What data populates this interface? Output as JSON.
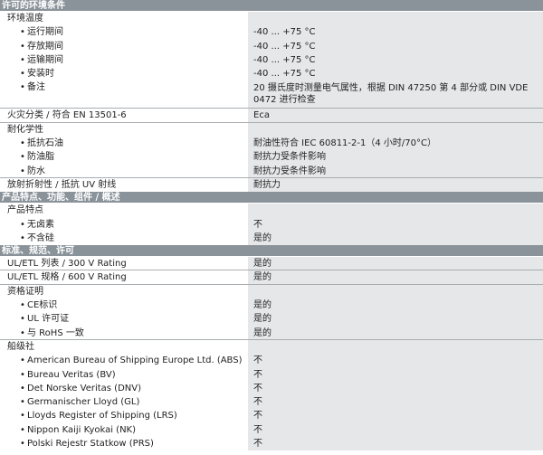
{
  "sections": [
    {
      "title": "许可的环境条件",
      "rows": [
        {
          "label": "环境温度",
          "value": "",
          "level": 0,
          "sep": false
        },
        {
          "label": "运行期间",
          "value": "-40 ... +75 °C",
          "level": 1,
          "sep": false
        },
        {
          "label": "存放期间",
          "value": "-40 ... +75 °C",
          "level": 1,
          "sep": false
        },
        {
          "label": "运输期间",
          "value": "-40 ... +75 °C",
          "level": 1,
          "sep": false
        },
        {
          "label": "安装时",
          "value": "-40 ... +75 °C",
          "level": 1,
          "sep": false
        },
        {
          "label": "备注",
          "value": "20 摄氏度时测量电气属性，根据 DIN 47250 第 4 部分或 DIN VDE 0472 进行检查",
          "level": 1,
          "sep": true,
          "tall": true
        },
        {
          "label": "火灾分类 / 符合 EN 13501-6",
          "value": "Eca",
          "level": 0,
          "sep": true
        },
        {
          "label": "耐化学性",
          "value": "",
          "level": 0,
          "sep": false
        },
        {
          "label": "抵抗石油",
          "value": "耐油性符合 IEC 60811-2-1（4 小时/70°C）",
          "level": 1,
          "sep": false
        },
        {
          "label": "防油脂",
          "value": "耐抗力受条件影响",
          "level": 1,
          "sep": false
        },
        {
          "label": "防水",
          "value": "耐抗力受条件影响",
          "level": 1,
          "sep": true
        },
        {
          "label": "放射折射性 / 抵抗 UV 射线",
          "value": "耐抗力",
          "level": 0,
          "sep": false
        }
      ]
    },
    {
      "title": "产品特点、功能、组件 / 概述",
      "rows": [
        {
          "label": "产品特点",
          "value": "",
          "level": 0,
          "sep": false
        },
        {
          "label": "无卤素",
          "value": "不",
          "level": 1,
          "sep": false
        },
        {
          "label": "不含硅",
          "value": "是的",
          "level": 1,
          "sep": false
        }
      ]
    },
    {
      "title": "标准、规范、许可",
      "rows": [
        {
          "label": "UL/ETL 列表 / 300 V Rating",
          "value": "是的",
          "level": 0,
          "sep": true
        },
        {
          "label": "UL/ETL 规格 / 600 V Rating",
          "value": "是的",
          "level": 0,
          "sep": true
        },
        {
          "label": "资格证明",
          "value": "",
          "level": 0,
          "sep": false
        },
        {
          "label": "CE标识",
          "value": "是的",
          "level": 1,
          "sep": false
        },
        {
          "label": "UL 许可证",
          "value": "是的",
          "level": 1,
          "sep": false
        },
        {
          "label": "与 RoHS 一致",
          "value": "是的",
          "level": 1,
          "sep": true
        },
        {
          "label": "船级社",
          "value": "",
          "level": 0,
          "sep": false
        },
        {
          "label": "American Bureau of Shipping Europe Ltd. (ABS)",
          "value": "不",
          "level": 1,
          "sep": false
        },
        {
          "label": "Bureau Veritas (BV)",
          "value": "不",
          "level": 1,
          "sep": false
        },
        {
          "label": "Det Norske Veritas (DNV)",
          "value": "不",
          "level": 1,
          "sep": false
        },
        {
          "label": "Germanischer Lloyd (GL)",
          "value": "不",
          "level": 1,
          "sep": false
        },
        {
          "label": "Lloyds Register of Shipping (LRS)",
          "value": "不",
          "level": 1,
          "sep": false
        },
        {
          "label": "Nippon Kaiji Kyokai (NK)",
          "value": "不",
          "level": 1,
          "sep": false
        },
        {
          "label": "Polski Rejestr Statkow (PRS)",
          "value": "不",
          "level": 1,
          "sep": false
        }
      ]
    }
  ]
}
